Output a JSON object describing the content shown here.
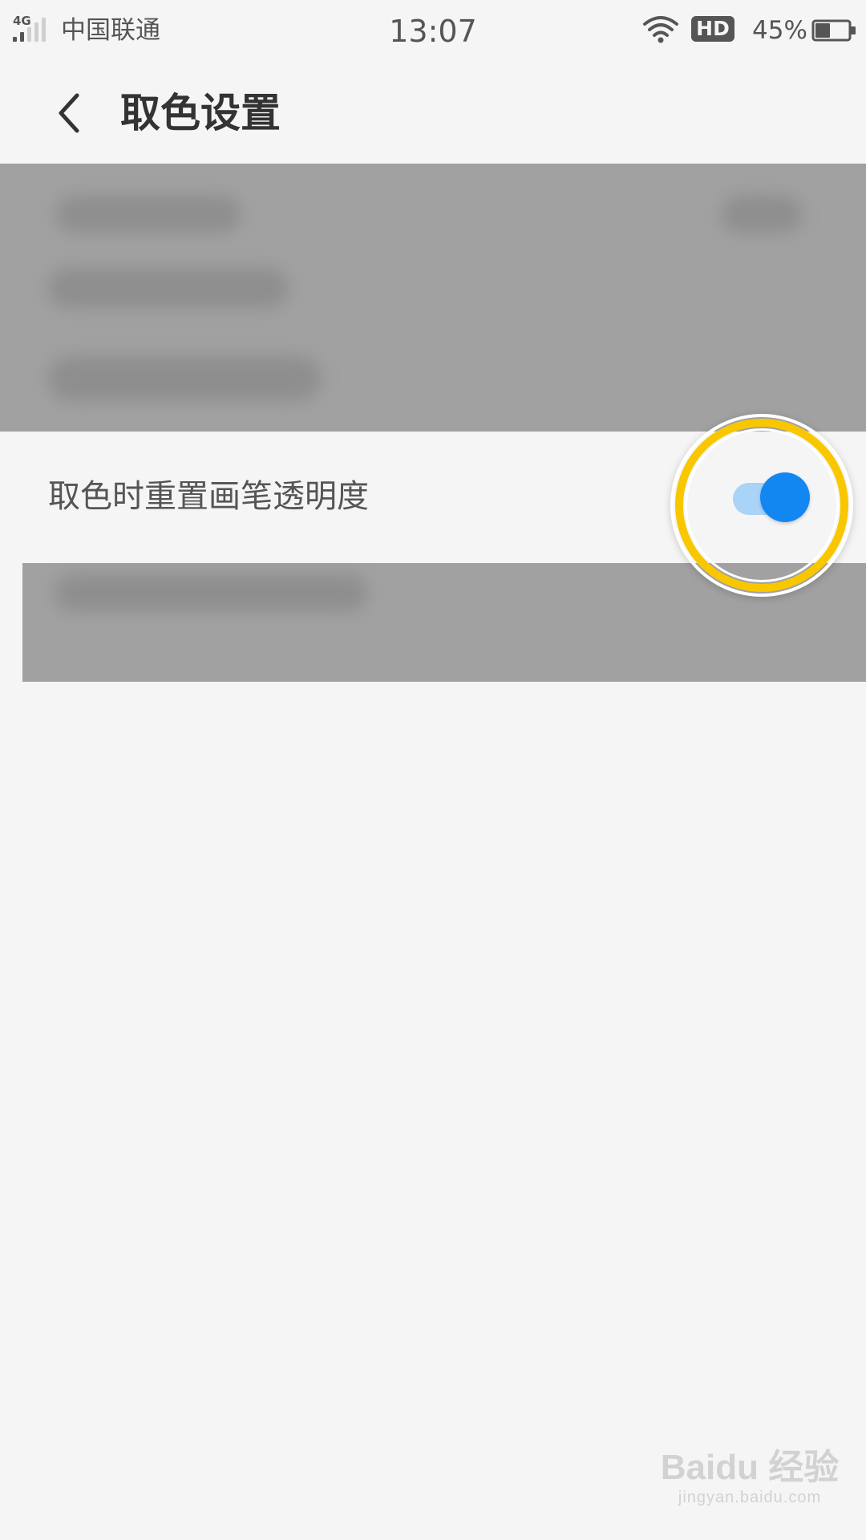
{
  "status_bar": {
    "network": "4G",
    "carrier": "中国联通",
    "time": "13:07",
    "hd_badge": "HD",
    "battery_percent": "45%",
    "battery_level": 0.45,
    "icons": [
      "signal-icon",
      "wifi-icon",
      "battery-icon"
    ]
  },
  "header": {
    "back_icon": "chevron-left-icon",
    "title": "取色设置"
  },
  "settings": {
    "items": [
      {
        "label": "取色时重置画笔透明度",
        "toggle_on": true
      }
    ]
  },
  "colors": {
    "background": "#f5f5f5",
    "toggle_track": "#a9d3f7",
    "toggle_knob": "#1287f2",
    "highlight_ring": "#f8c700",
    "redacted": "#a1a1a1"
  },
  "watermark": {
    "brand": "Baidu 经验",
    "url": "jingyan.baidu.com"
  }
}
